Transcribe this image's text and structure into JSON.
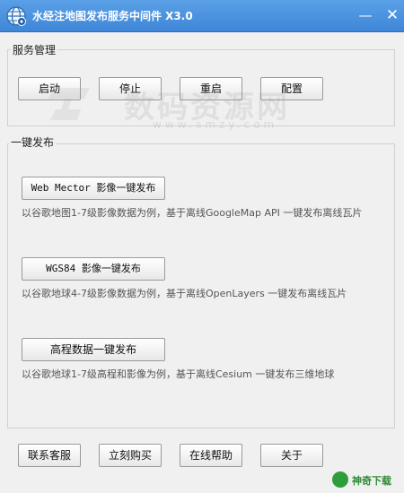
{
  "window": {
    "title": "水经注地图发布服务中间件 X3.0",
    "minimize_glyph": "—",
    "close_glyph": "✕",
    "app_icon": "globe-gear-icon"
  },
  "service_group": {
    "legend": "服务管理",
    "buttons": [
      "启动",
      "停止",
      "重启",
      "配置"
    ]
  },
  "publish_group": {
    "legend": "一键发布",
    "items": [
      {
        "button": "Web Mector 影像一键发布",
        "desc": "以谷歌地图1-7级影像数据为例，基于离线GoogleMap API 一键发布离线瓦片"
      },
      {
        "button": "WGS84 影像一键发布",
        "desc": "以谷歌地球4-7级影像数据为例，基于离线OpenLayers 一键发布离线瓦片"
      },
      {
        "button": "高程数据一键发布",
        "desc": "以谷歌地球1-7级高程和影像为例，基于离线Cesium 一键发布三维地球"
      }
    ]
  },
  "footer": {
    "buttons": [
      "联系客服",
      "立刻购买",
      "在线帮助",
      "关于"
    ]
  },
  "watermark": {
    "text": "数码资源网",
    "sub": "www.smzy.com"
  },
  "brand": {
    "text": "神奇下载"
  },
  "colors": {
    "titlebar": "#3f86d8",
    "background": "#f0f0f0",
    "brand": "#2e9e3a"
  }
}
